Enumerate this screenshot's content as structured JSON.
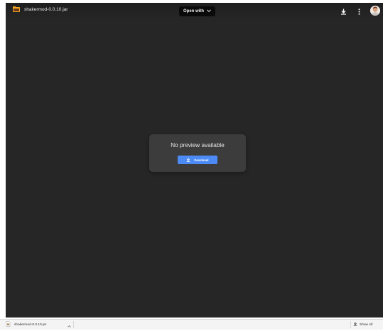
{
  "header": {
    "file_name": "shakermod-0.0.10.jar",
    "open_with_label": "Open with",
    "icons": [
      "file-type-icon",
      "chevron-down-icon",
      "download-icon",
      "more-vert-icon",
      "avatar"
    ]
  },
  "preview": {
    "message": "No preview available",
    "download_label": "Download",
    "accent_color": "#4c8bf5"
  },
  "download_bar": {
    "item_name": "shakermod-0.0.10.jar",
    "show_all_label": "Show All"
  }
}
